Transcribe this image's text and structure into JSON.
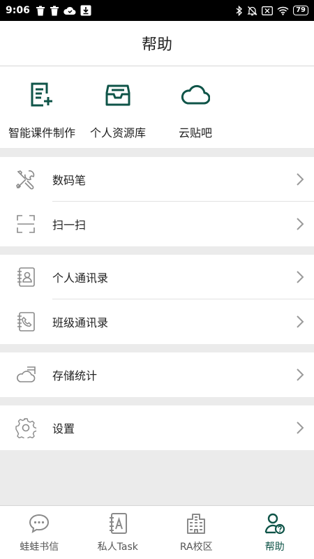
{
  "colors": {
    "accent": "#0f5448",
    "icon_gray": "#8a8a8a",
    "background": "#ebebeb"
  },
  "status_bar": {
    "time": "9:06",
    "battery": "79"
  },
  "header": {
    "title": "帮助"
  },
  "quick_actions": [
    {
      "label": "智能课件制作",
      "icon": "document-add-icon"
    },
    {
      "label": "个人资源库",
      "icon": "inbox-icon"
    },
    {
      "label": "云贴吧",
      "icon": "cloud-icon"
    }
  ],
  "menu": {
    "digital_pen": "数码笔",
    "scan": "扫一扫",
    "personal_contacts": "个人通讯录",
    "class_contacts": "班级通讯录",
    "storage_stats": "存储统计",
    "settings": "设置"
  },
  "tabs": [
    {
      "label": "蛙蛙书信",
      "icon": "chat-bubble-icon",
      "active": false
    },
    {
      "label": "私人Task",
      "icon": "notebook-a-icon",
      "active": false
    },
    {
      "label": "RA校区",
      "icon": "building-icon",
      "active": false
    },
    {
      "label": "帮助",
      "icon": "user-help-icon",
      "active": true
    }
  ]
}
